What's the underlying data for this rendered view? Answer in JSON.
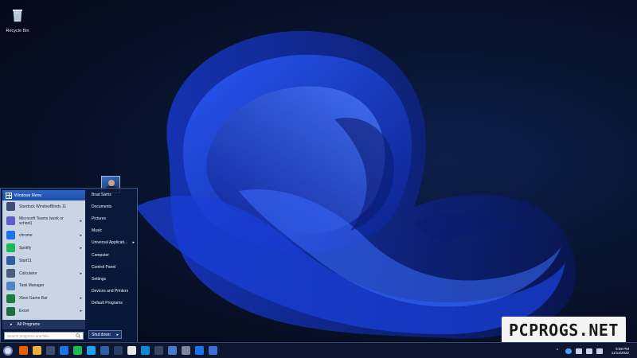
{
  "desktop": {
    "icons": [
      {
        "label": "Recycle Bin",
        "icon": "recycle-bin-icon"
      }
    ]
  },
  "start_menu": {
    "header_title": "Windows Menu",
    "programs": [
      {
        "label": "Stardock WindowBlinds 11",
        "icon": "windowblinds-icon",
        "color": "#3d4e72",
        "has_submenu": false
      },
      {
        "label": "Microsoft Teams (work or school)",
        "icon": "teams-icon",
        "color": "#5b5fc7",
        "has_submenu": true
      },
      {
        "label": "chrome",
        "icon": "chrome-icon",
        "color": "#1a73e8",
        "has_submenu": true
      },
      {
        "label": "Spotify",
        "icon": "spotify-icon",
        "color": "#1db954",
        "has_submenu": true
      },
      {
        "label": "Start11",
        "icon": "start11-icon",
        "color": "#2e5fa8",
        "has_submenu": false
      },
      {
        "label": "Calculator",
        "icon": "calculator-icon",
        "color": "#4a5d7a",
        "has_submenu": true
      },
      {
        "label": "Task Manager",
        "icon": "task-manager-icon",
        "color": "#4e87c7",
        "has_submenu": false
      },
      {
        "label": "Xbox Game Bar",
        "icon": "xbox-icon",
        "color": "#1b7f3b",
        "has_submenu": true
      },
      {
        "label": "Excel",
        "icon": "excel-icon",
        "color": "#1d6f42",
        "has_submenu": true
      }
    ],
    "all_programs_label": "All Programs",
    "search_placeholder": "Search programs and files",
    "right_items": [
      {
        "label": "Brad Sams",
        "has_submenu": false
      },
      {
        "label": "Documents",
        "has_submenu": false
      },
      {
        "label": "Pictures",
        "has_submenu": false
      },
      {
        "label": "Music",
        "has_submenu": false
      },
      {
        "label": "Universal Applicati...",
        "has_submenu": true
      },
      {
        "label": "Computer",
        "has_submenu": false
      },
      {
        "label": "Control Panel",
        "has_submenu": false
      },
      {
        "label": "Settings",
        "has_submenu": false
      },
      {
        "label": "Devices and Printers",
        "has_submenu": false
      },
      {
        "label": "Default Programs",
        "has_submenu": false
      }
    ],
    "shutdown_label": "Shut down",
    "shutdown_arrow": "▸"
  },
  "watermark": {
    "text": "PCPROGS.NET"
  },
  "taskbar": {
    "apps": [
      {
        "icon": "firefox-icon",
        "color": "#e66000"
      },
      {
        "icon": "file-explorer-icon",
        "color": "#e8b23a"
      },
      {
        "icon": "windowblinds-icon",
        "color": "#3d4e72"
      },
      {
        "icon": "1password-icon",
        "color": "#1a73e8"
      },
      {
        "icon": "spotify-icon",
        "color": "#1db954"
      },
      {
        "icon": "twitter-icon",
        "color": "#1da1f2"
      },
      {
        "icon": "start11-icon",
        "color": "#2e5fa8"
      },
      {
        "icon": "network-icon",
        "color": "#2d3e66"
      },
      {
        "icon": "notion-icon",
        "color": "#e8e8e8"
      },
      {
        "icon": "edge-icon",
        "color": "#0c8ad6"
      },
      {
        "icon": "terminal-icon",
        "color": "#3a4660"
      },
      {
        "icon": "photos-icon",
        "color": "#4a7bd0"
      },
      {
        "icon": "settings-icon",
        "color": "#7b8699"
      },
      {
        "icon": "chrome-icon",
        "color": "#1a73e8"
      },
      {
        "icon": "store-icon",
        "color": "#3b6fd6"
      }
    ],
    "clock_time": "5:58 PM",
    "clock_date": "11/14/2022"
  },
  "colors": {
    "accent": "#2b64c9",
    "desktop": "#08142f",
    "taskbar": "#0d1730"
  }
}
